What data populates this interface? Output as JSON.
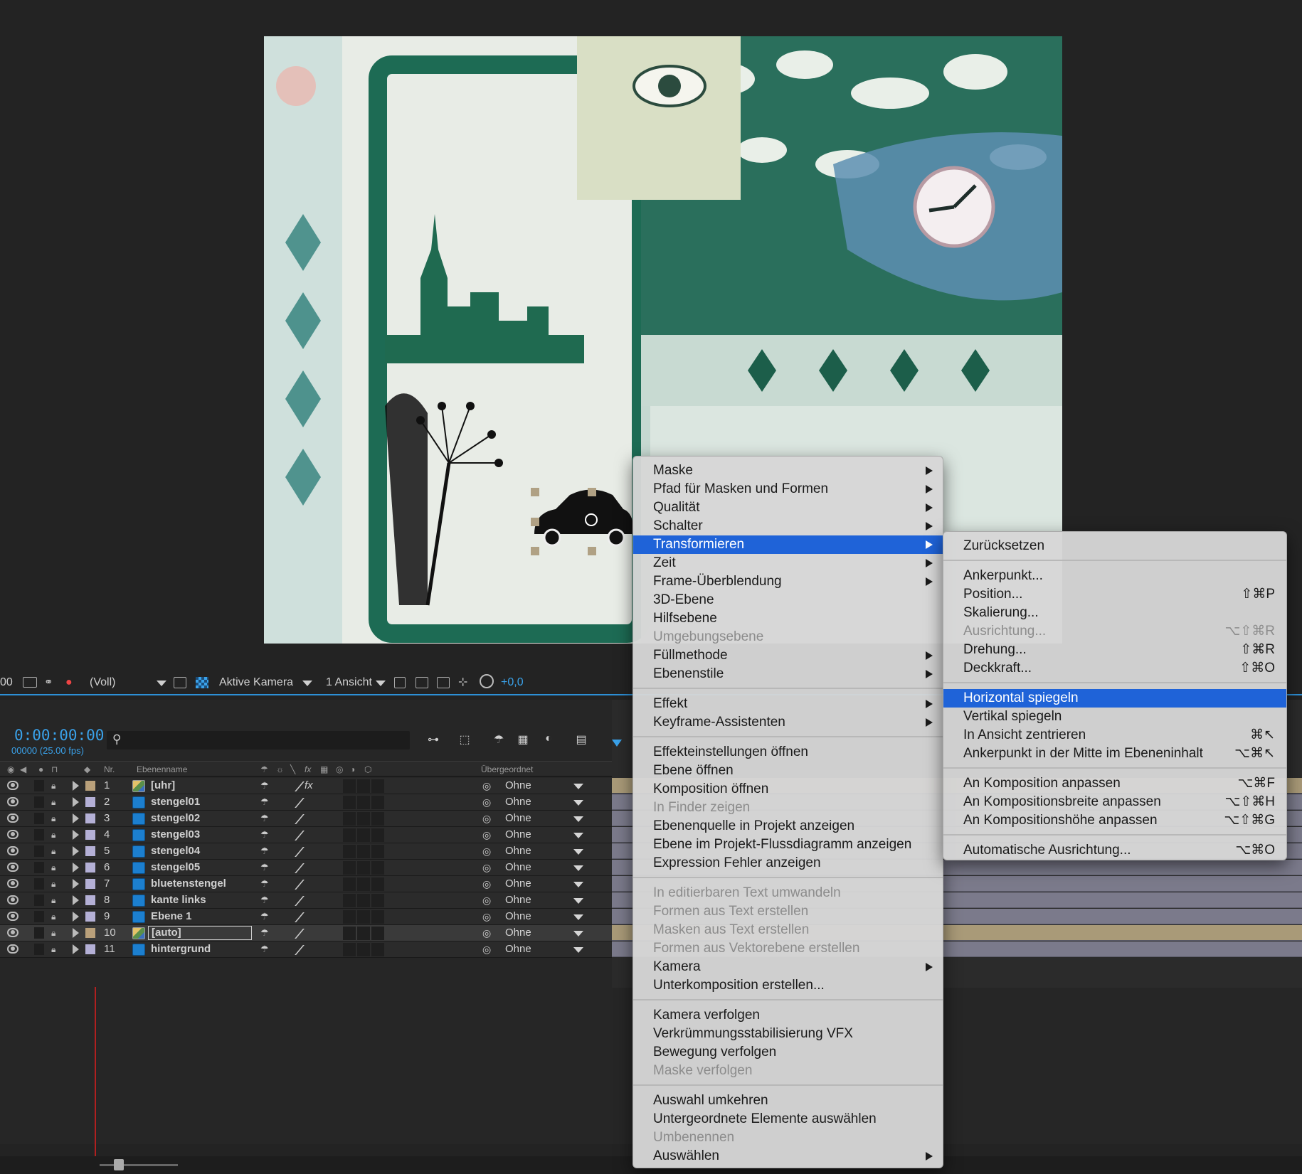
{
  "viewer_toolbar": {
    "frame_label": "00",
    "resolution": "(Voll)",
    "camera": "Aktive Kamera",
    "views": "1 Ansicht",
    "exposure": "+0,0"
  },
  "timeline": {
    "timecode": "0:00:00:00",
    "frame_info": "00000 (25.00 fps)",
    "search_placeholder": "",
    "columns": {
      "nr": "Nr.",
      "name": "Ebenenname",
      "parent": "Übergeordnet"
    },
    "layers": [
      {
        "nr": "1",
        "name": "[uhr]",
        "parent": "Ohne",
        "label_color": "#b9a07a",
        "icon": "comp-icon",
        "fx": true
      },
      {
        "nr": "2",
        "name": "stengel01",
        "parent": "Ohne",
        "label_color": "#b4b0d6",
        "icon": "psd-icon",
        "fx": false
      },
      {
        "nr": "3",
        "name": "stengel02",
        "parent": "Ohne",
        "label_color": "#b4b0d6",
        "icon": "psd-icon",
        "fx": false
      },
      {
        "nr": "4",
        "name": "stengel03",
        "parent": "Ohne",
        "label_color": "#b4b0d6",
        "icon": "psd-icon",
        "fx": false
      },
      {
        "nr": "5",
        "name": "stengel04",
        "parent": "Ohne",
        "label_color": "#b4b0d6",
        "icon": "psd-icon",
        "fx": false
      },
      {
        "nr": "6",
        "name": "stengel05",
        "parent": "Ohne",
        "label_color": "#b4b0d6",
        "icon": "psd-icon",
        "fx": false
      },
      {
        "nr": "7",
        "name": "bluetenstengel",
        "parent": "Ohne",
        "label_color": "#b4b0d6",
        "icon": "psd-icon",
        "fx": false
      },
      {
        "nr": "8",
        "name": "kante links",
        "parent": "Ohne",
        "label_color": "#b4b0d6",
        "icon": "psd-icon",
        "fx": false
      },
      {
        "nr": "9",
        "name": "Ebene 1",
        "parent": "Ohne",
        "label_color": "#b4b0d6",
        "icon": "psd-icon",
        "fx": false
      },
      {
        "nr": "10",
        "name": "[auto]",
        "parent": "Ohne",
        "label_color": "#b9a07a",
        "icon": "comp-icon",
        "fx": false,
        "selected": true
      },
      {
        "nr": "11",
        "name": "hintergrund",
        "parent": "Ohne",
        "label_color": "#b4b0d6",
        "icon": "psd-icon",
        "fx": false
      }
    ]
  },
  "context_menu": {
    "items": [
      {
        "label": "Maske",
        "submenu": true
      },
      {
        "label": "Pfad für Masken und Formen",
        "submenu": true
      },
      {
        "label": "Qualität",
        "submenu": true
      },
      {
        "label": "Schalter",
        "submenu": true
      },
      {
        "label": "Transformieren",
        "submenu": true,
        "highlight": true
      },
      {
        "label": "Zeit",
        "submenu": true
      },
      {
        "label": "Frame-Überblendung",
        "submenu": true
      },
      {
        "label": "3D-Ebene"
      },
      {
        "label": "Hilfsebene"
      },
      {
        "label": "Umgebungsebene",
        "disabled": true
      },
      {
        "label": "Füllmethode",
        "submenu": true
      },
      {
        "label": "Ebenenstile",
        "submenu": true
      },
      {
        "separator": true
      },
      {
        "label": "Effekt",
        "submenu": true
      },
      {
        "label": "Keyframe-Assistenten",
        "submenu": true
      },
      {
        "separator": true
      },
      {
        "label": "Effekteinstellungen öffnen"
      },
      {
        "label": "Ebene öffnen"
      },
      {
        "label": "Komposition öffnen"
      },
      {
        "label": "In Finder zeigen",
        "disabled": true
      },
      {
        "label": "Ebenenquelle in Projekt anzeigen"
      },
      {
        "label": "Ebene im Projekt-Flussdiagramm anzeigen"
      },
      {
        "label": "Expression Fehler anzeigen"
      },
      {
        "separator": true
      },
      {
        "label": "In editierbaren Text umwandeln",
        "disabled": true
      },
      {
        "label": "Formen aus Text erstellen",
        "disabled": true
      },
      {
        "label": "Masken aus Text erstellen",
        "disabled": true
      },
      {
        "label": "Formen aus Vektorebene erstellen",
        "disabled": true
      },
      {
        "label": "Kamera",
        "submenu": true
      },
      {
        "label": "Unterkomposition erstellen..."
      },
      {
        "separator": true
      },
      {
        "label": "Kamera verfolgen"
      },
      {
        "label": "Verkrümmungsstabilisierung VFX"
      },
      {
        "label": "Bewegung verfolgen"
      },
      {
        "label": "Maske verfolgen",
        "disabled": true
      },
      {
        "separator": true
      },
      {
        "label": "Auswahl umkehren"
      },
      {
        "label": "Untergeordnete Elemente auswählen"
      },
      {
        "label": "Umbenennen",
        "disabled": true
      },
      {
        "label": "Auswählen",
        "submenu": true
      }
    ]
  },
  "transform_submenu": {
    "items": [
      {
        "label": "Zurücksetzen"
      },
      {
        "separator": true
      },
      {
        "label": "Ankerpunkt..."
      },
      {
        "label": "Position...",
        "shortcut": "⇧⌘P"
      },
      {
        "label": "Skalierung..."
      },
      {
        "label": "Ausrichtung...",
        "shortcut": "⌥⇧⌘R",
        "disabled": true
      },
      {
        "label": "Drehung...",
        "shortcut": "⇧⌘R"
      },
      {
        "label": "Deckkraft...",
        "shortcut": "⇧⌘O"
      },
      {
        "separator": true
      },
      {
        "label": "Horizontal spiegeln",
        "highlight": true
      },
      {
        "label": "Vertikal spiegeln"
      },
      {
        "label": "In Ansicht zentrieren",
        "shortcut": "⌘↖"
      },
      {
        "label": "Ankerpunkt in der Mitte im Ebeneninhalt",
        "shortcut": "⌥⌘↖"
      },
      {
        "separator": true
      },
      {
        "label": "An Komposition anpassen",
        "shortcut": "⌥⌘F"
      },
      {
        "label": "An Kompositionsbreite anpassen",
        "shortcut": "⌥⇧⌘H"
      },
      {
        "label": "An Kompositionshöhe anpassen",
        "shortcut": "⌥⇧⌘G"
      },
      {
        "separator": true
      },
      {
        "label": "Automatische Ausrichtung...",
        "shortcut": "⌥⌘O"
      }
    ]
  },
  "colors": {
    "accent": "#3aa2ea",
    "menu_highlight": "#1f63d8",
    "track_layer": "#7b7a8b",
    "track_comp": "#a99a78"
  }
}
